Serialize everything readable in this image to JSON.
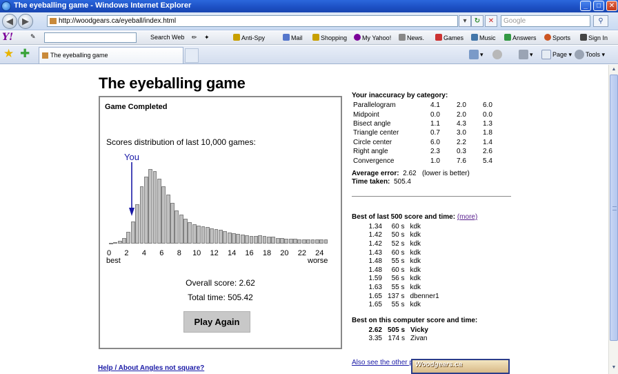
{
  "window": {
    "title": "The eyeballing game - Windows Internet Explorer",
    "minimize": "_",
    "maximize": "□",
    "close": "✕"
  },
  "browser": {
    "back": "◀",
    "forward": "▶",
    "url": "http://woodgears.ca/eyeball/index.html",
    "search_placeholder": "Google",
    "tab_title": "The eyeballing game",
    "go": "↻",
    "stop": "✕",
    "search_go": "⚲"
  },
  "yahoo_toolbar": {
    "logo": "Y!",
    "search_web": "Search Web",
    "items": [
      {
        "label": "Anti-Spy",
        "color": "#c8a000"
      },
      {
        "label": "Mail",
        "color": "#5577cc"
      },
      {
        "label": "Shopping",
        "color": "#c8a000"
      },
      {
        "label": "My Yahoo!",
        "color": "#7b0099"
      },
      {
        "label": "News.",
        "color": "#888888"
      },
      {
        "label": "Games",
        "color": "#cc3333"
      },
      {
        "label": "Music",
        "color": "#4477aa"
      },
      {
        "label": "Answers",
        "color": "#339944"
      },
      {
        "label": "Sports",
        "color": "#cc5522"
      },
      {
        "label": "Sign In",
        "color": "#444444"
      }
    ]
  },
  "command_bar": {
    "page": "Page",
    "tools": "Tools"
  },
  "page": {
    "title": "The eyeballing game",
    "game_status": "Game Completed",
    "distribution_title": "Scores distribution of last 10,000 games:",
    "you_label": "You",
    "best_label": "best",
    "worse_label": "worse",
    "overall_score": "Overall score: 2.62",
    "total_time": "Total time: 505.42",
    "play_again": "Play Again",
    "footer_links": "Help / About   Angles not square?",
    "also_see": "Also see the other parts of",
    "woodgears": "Woodgears.ca"
  },
  "chart_data": {
    "type": "bar",
    "title": "Scores distribution of last 10,000 games:",
    "xlabel": "",
    "ylabel": "",
    "x_tick_labels": [
      "0",
      "2",
      "4",
      "6",
      "8",
      "10",
      "12",
      "14",
      "16",
      "18",
      "20",
      "22",
      "24"
    ],
    "x_range": [
      0,
      25
    ],
    "x_start_label": "best",
    "x_end_label": "worse",
    "marker": {
      "label": "You",
      "x": 2.62
    },
    "bin_width": 0.5,
    "bin_starts": [
      0,
      0.5,
      1,
      1.5,
      2,
      2.5,
      3,
      3.5,
      4,
      4.5,
      5,
      5.5,
      6,
      6.5,
      7,
      7.5,
      8,
      8.5,
      9,
      9.5,
      10,
      10.5,
      11,
      11.5,
      12,
      12.5,
      13,
      13.5,
      14,
      14.5,
      15,
      15.5,
      16,
      16.5,
      17,
      17.5,
      18,
      18.5,
      19,
      19.5,
      20,
      20.5,
      21,
      21.5,
      22,
      22.5,
      23,
      23.5,
      24,
      24.5
    ],
    "values": [
      1,
      2,
      4,
      8,
      16,
      30,
      54,
      78,
      92,
      102,
      99,
      89,
      78,
      67,
      56,
      45,
      40,
      34,
      29,
      26,
      25,
      24,
      23,
      21,
      20,
      19,
      17,
      15,
      14,
      13,
      12,
      11,
      10,
      10,
      11,
      10,
      9,
      9,
      8,
      8,
      7,
      7,
      7,
      6,
      6,
      6,
      6,
      6,
      6,
      6
    ]
  },
  "categories": {
    "title": "Your inaccuracy by category:",
    "rows": [
      {
        "name": "Parallelogram",
        "a": "4.1",
        "b": "2.0",
        "c": "6.0"
      },
      {
        "name": "Midpoint",
        "a": "0.0",
        "b": "2.0",
        "c": "0.0"
      },
      {
        "name": "Bisect angle",
        "a": "1.1",
        "b": "4.3",
        "c": "1.3"
      },
      {
        "name": "Triangle center",
        "a": "0.7",
        "b": "3.0",
        "c": "1.8"
      },
      {
        "name": "Circle center",
        "a": "6.0",
        "b": "2.2",
        "c": "1.4"
      },
      {
        "name": "Right angle",
        "a": "2.3",
        "b": "0.3",
        "c": "2.6"
      },
      {
        "name": "Convergence",
        "a": "1.0",
        "b": "7.6",
        "c": "5.4"
      }
    ],
    "average_error_label": "Average error:",
    "average_error_value": "2.62",
    "average_error_note": "(lower is better)",
    "time_taken_label": "Time taken:",
    "time_taken_value": "505.4"
  },
  "best500": {
    "title": "Best of last 500 score and time:",
    "more": "(more)",
    "rows": [
      {
        "score": "1.34",
        "time": "60 s",
        "name": "kdk"
      },
      {
        "score": "1.42",
        "time": "50 s",
        "name": "kdk"
      },
      {
        "score": "1.42",
        "time": "52 s",
        "name": "kdk"
      },
      {
        "score": "1.43",
        "time": "60 s",
        "name": "kdk"
      },
      {
        "score": "1.48",
        "time": "55 s",
        "name": "kdk"
      },
      {
        "score": "1.48",
        "time": "60 s",
        "name": "kdk"
      },
      {
        "score": "1.59",
        "time": "56 s",
        "name": "kdk"
      },
      {
        "score": "1.63",
        "time": "55 s",
        "name": "kdk"
      },
      {
        "score": "1.65",
        "time": "137 s",
        "name": "dbenner1"
      },
      {
        "score": "1.65",
        "time": "55 s",
        "name": "kdk"
      }
    ]
  },
  "best_computer": {
    "title": "Best on this computer score and time:",
    "rows": [
      {
        "score": "2.62",
        "time": "505 s",
        "name": "Vicky",
        "highlight": true
      },
      {
        "score": "3.35",
        "time": "174 s",
        "name": "Zivan",
        "highlight": false
      }
    ]
  }
}
